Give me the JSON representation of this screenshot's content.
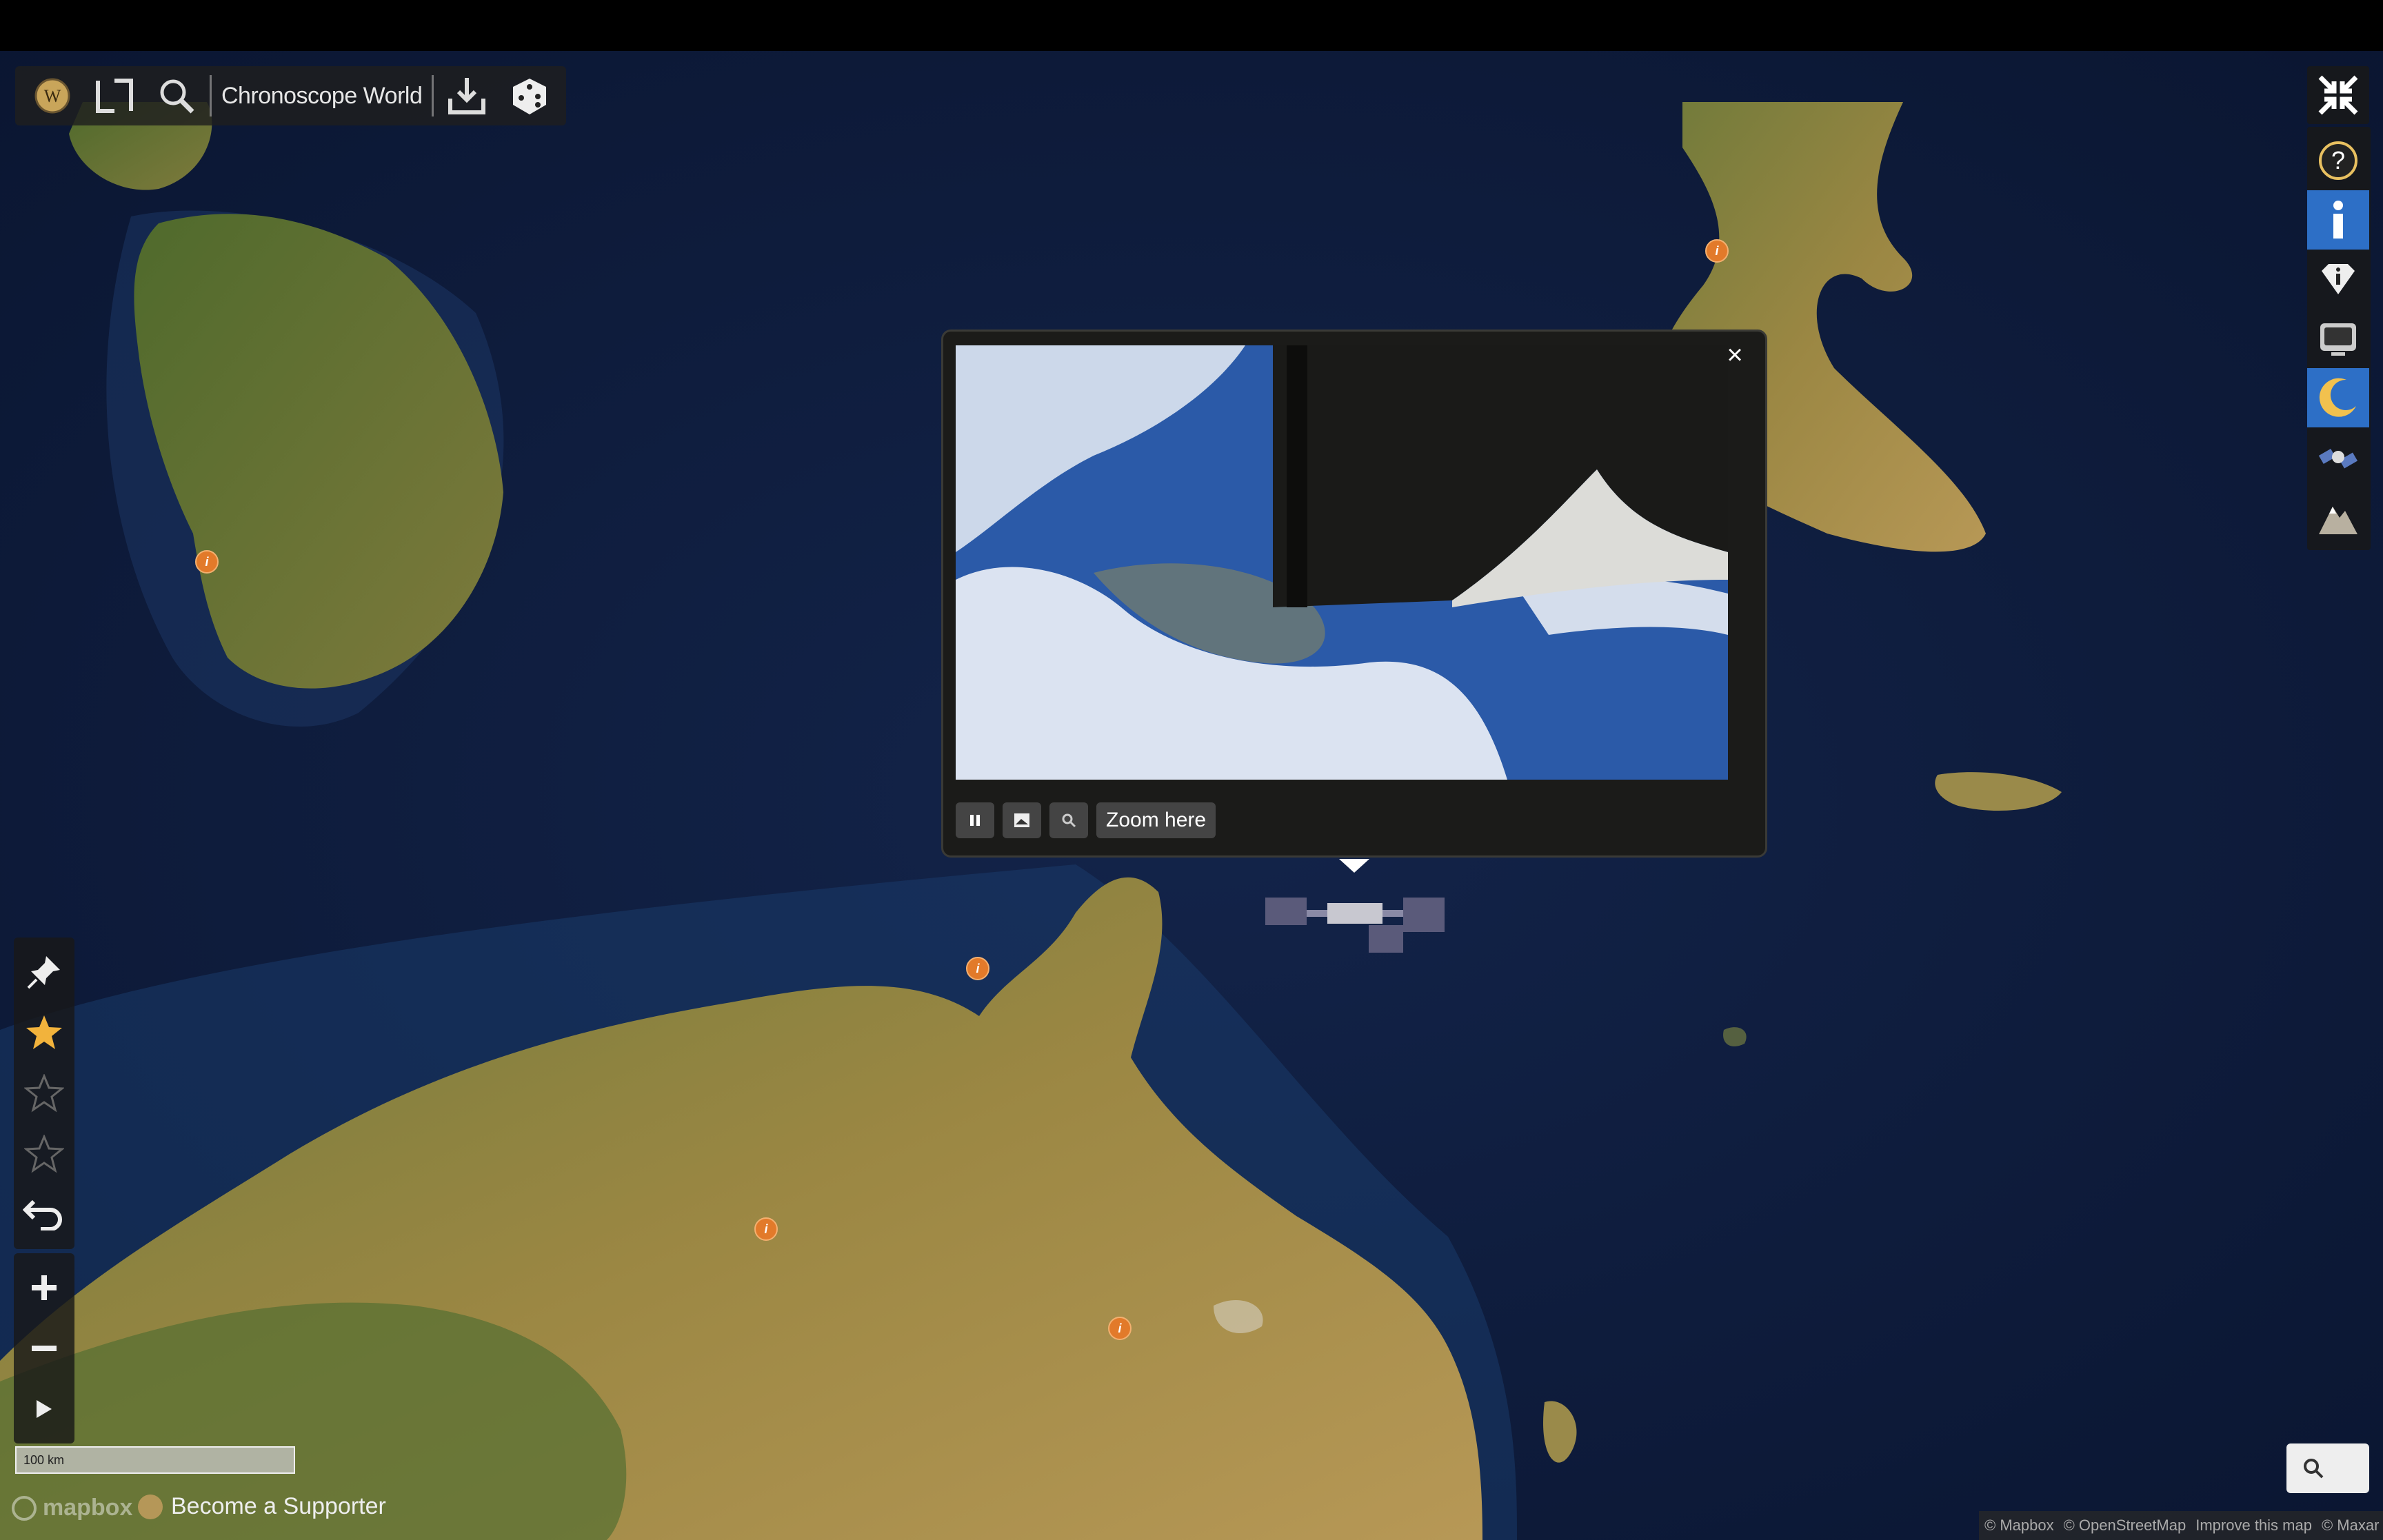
{
  "toolbar": {
    "title": "Chronoscope World",
    "logo_icon": "wikipedia-logo-icon",
    "icons": [
      "bracket-frame-icon",
      "search-icon",
      "download-icon",
      "dice-icon"
    ]
  },
  "right_toolbar": {
    "icons": [
      "collapse-icon",
      "help-icon",
      "info-icon",
      "diamond-info-icon",
      "tv-icon",
      "moon-icon",
      "satellite-icon",
      "mountain-icon"
    ],
    "active": [
      "info-icon",
      "moon-icon"
    ]
  },
  "left_toolbar": {
    "icons": [
      "pin-icon",
      "star-filled-icon",
      "star-outline-icon",
      "star-outline-icon",
      "undo-icon"
    ]
  },
  "zoom_controls": {
    "icons": [
      "zoom-in-icon",
      "zoom-out-icon",
      "play-icon"
    ]
  },
  "popup": {
    "zoom_here_label": "Zoom here",
    "close_label": "×",
    "controls": [
      "pause-icon",
      "image-icon",
      "search-icon"
    ]
  },
  "scale_bar": {
    "label": "100 km"
  },
  "footer": {
    "mapbox_label": "mapbox",
    "supporter_label": "Become a Supporter",
    "attribution": [
      "© Mapbox",
      "© OpenStreetMap",
      "Improve this map",
      "© Maxar"
    ]
  },
  "colors": {
    "accent": "#2d6fc6",
    "marker": "#e27a2a",
    "sea": "#0e1b33",
    "land": "#8a7a3e"
  }
}
